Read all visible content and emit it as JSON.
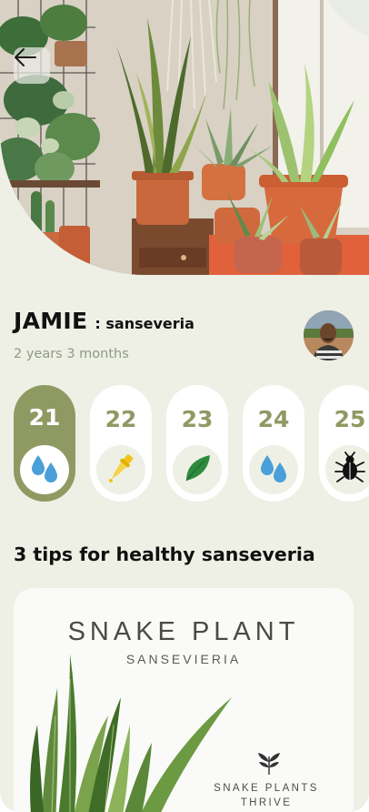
{
  "header": {
    "hero_image": "potted snake plants and succulents on window shelves",
    "back_icon": "arrow-left-icon"
  },
  "profile": {
    "name": "JAMIE",
    "plant": ": sanseveria",
    "age": "2 years 3 months",
    "avatar_image": "user portrait photo"
  },
  "days": [
    {
      "number": "21",
      "icon": "water-drops-icon",
      "active": true
    },
    {
      "number": "22",
      "icon": "fertilizer-dropper-icon",
      "active": false
    },
    {
      "number": "23",
      "icon": "leaf-icon",
      "active": false
    },
    {
      "number": "24",
      "icon": "water-drops-icon",
      "active": false
    },
    {
      "number": "25",
      "icon": "bug-icon",
      "active": false
    }
  ],
  "tips": {
    "title": "3 tips for healthy sanseveria",
    "card": {
      "title": "SNAKE PLANT",
      "subtitle": "SANSEVIERIA",
      "footer_line1": "SNAKE PLANTS",
      "footer_line2": "THRIVE"
    }
  },
  "colors": {
    "background": "#eef0e6",
    "accent": "#8f9a63",
    "muted_text": "#8f9a7f",
    "water_blue": "#4a9fd8",
    "leaf_green": "#2e8b3d",
    "fertilizer_yellow": "#f0c419"
  }
}
